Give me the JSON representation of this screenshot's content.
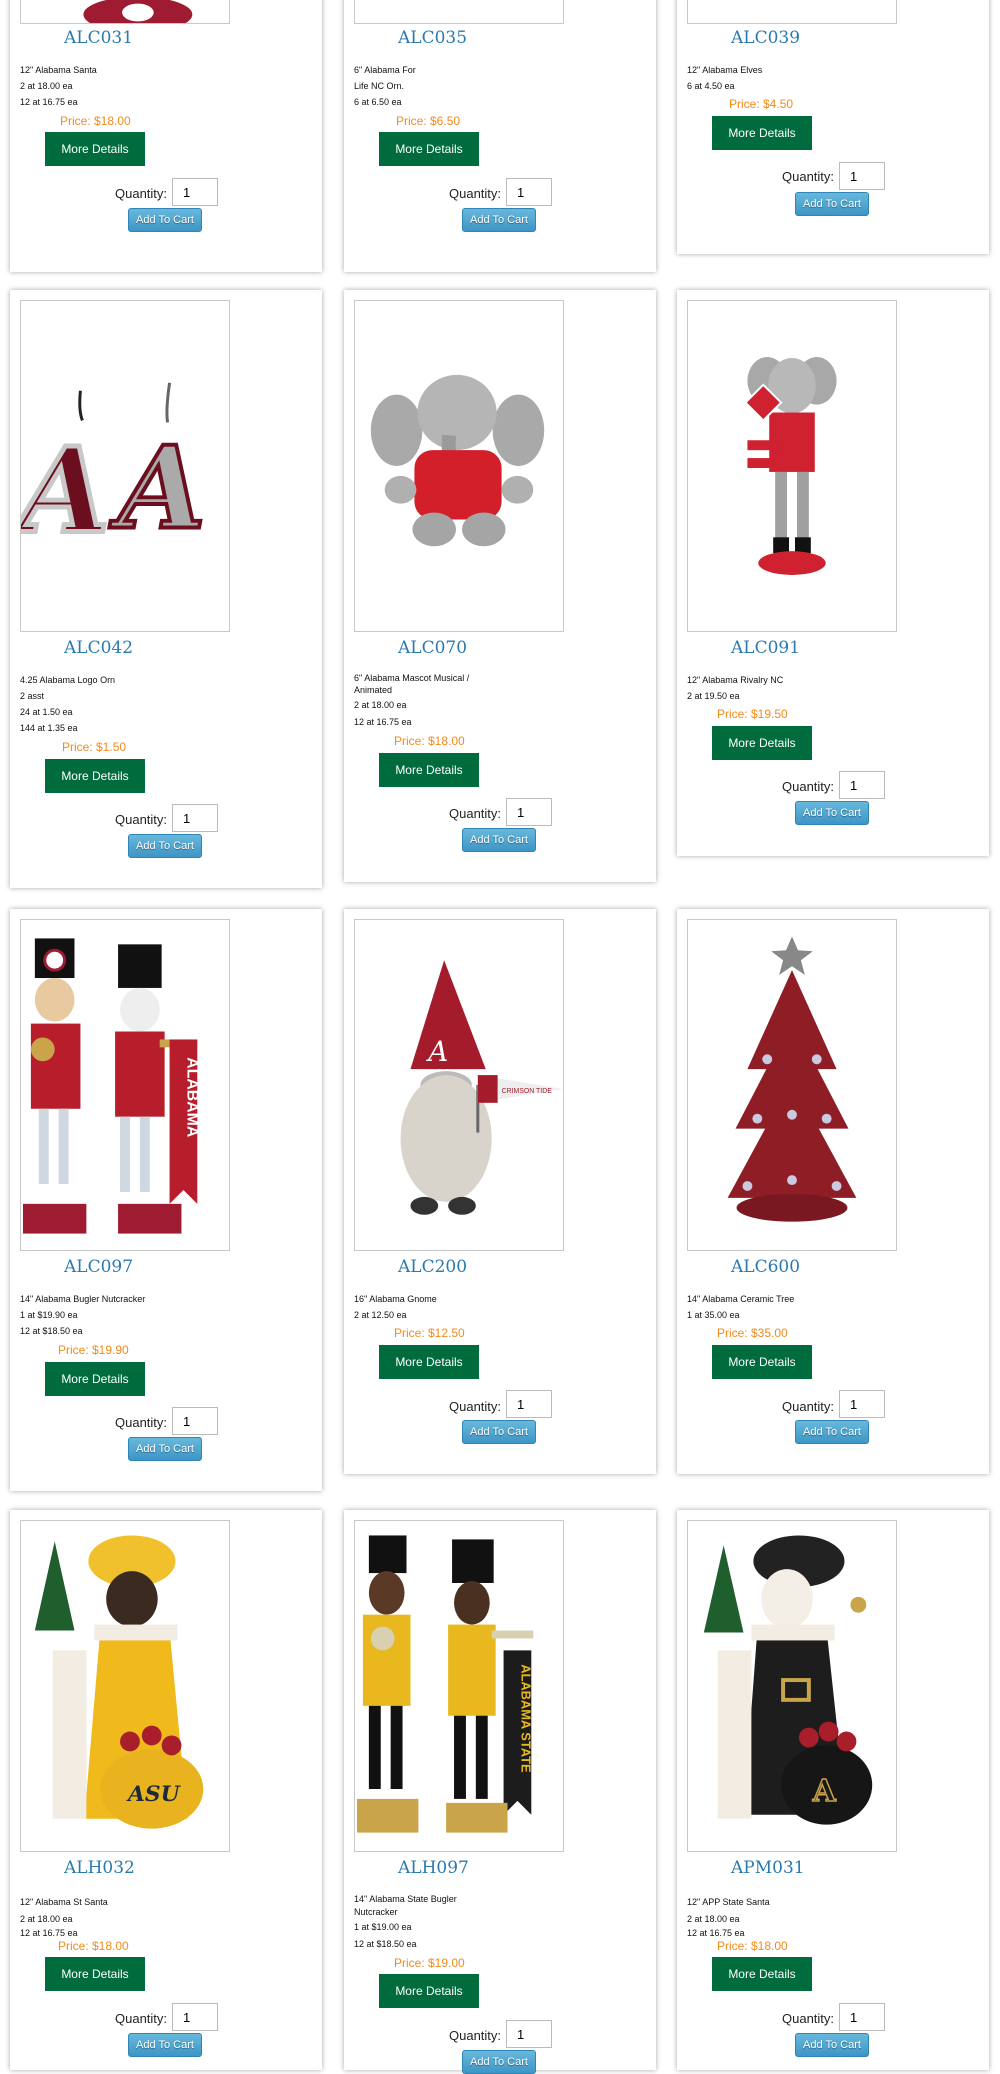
{
  "labels": {
    "more_details": "More Details",
    "quantity": "Quantity:",
    "add_to_cart": "Add To Cart",
    "default_qty": "1"
  },
  "products": {
    "alc031": {
      "code": "ALC031",
      "lines": [
        "12\" Alabama Santa",
        "2 at 18.00 ea",
        "12 at 16.75 ea"
      ],
      "price": "Price: $18.00"
    },
    "alc035": {
      "code": "ALC035",
      "lines": [
        "6\" Alabama For",
        "Life NC Orn.",
        "6 at 6.50 ea"
      ],
      "price": "Price: $6.50"
    },
    "alc039": {
      "code": "ALC039",
      "lines": [
        "12\" Alabama Elves",
        "6 at 4.50 ea"
      ],
      "price": "Price: $4.50"
    },
    "alc042": {
      "code": "ALC042",
      "lines": [
        "4.25 Alabama Logo Orn",
        "2 asst",
        "24 at 1.50 ea",
        "144 at 1.35 ea"
      ],
      "price": "Price: $1.50"
    },
    "alc070": {
      "code": "ALC070",
      "lines": [
        "6\" Alabama Mascot Musical /",
        "Animated",
        "2 at 18.00 ea",
        "12 at 16.75 ea"
      ],
      "price": "Price: $18.00"
    },
    "alc091": {
      "code": "ALC091",
      "lines": [
        "12\" Alabama Rivalry NC",
        "2 at 19.50 ea"
      ],
      "price": "Price: $19.50"
    },
    "alc097": {
      "code": "ALC097",
      "lines": [
        "14\" Alabama Bugler Nutcracker",
        "1 at $19.90 ea",
        "12 at $18.50 ea"
      ],
      "price": "Price: $19.90"
    },
    "alc200": {
      "code": "ALC200",
      "lines": [
        "16\" Alabama Gnome",
        "2 at 12.50 ea"
      ],
      "price": "Price: $12.50"
    },
    "alc600": {
      "code": "ALC600",
      "lines": [
        "14\" Alabama Ceramic Tree",
        "1 at 35.00 ea"
      ],
      "price": "Price: $35.00"
    },
    "alh032": {
      "code": "ALH032",
      "lines": [
        "12\" Alabama St Santa",
        "2 at 18.00 ea",
        "12 at 16.75 ea"
      ],
      "price": "Price: $18.00"
    },
    "alh097": {
      "code": "ALH097",
      "lines": [
        "14\" Alabama State Bugler",
        "Nutcracker",
        "1 at $19.00 ea",
        "12 at $18.50 ea"
      ],
      "price": "Price: $19.00"
    },
    "apm031": {
      "code": "APM031",
      "lines": [
        "12\" APP State Santa",
        "2 at 18.00 ea",
        "12 at 16.75 ea"
      ],
      "price": "Price: $18.00"
    }
  },
  "image_text": {
    "alabama_banner": "ALABAMA",
    "crimson_tide": "CRIMSON TIDE",
    "alabama_state_banner": "ALABAMA STATE",
    "asu": "ASU"
  },
  "colors": {
    "button_green": "#006b3c",
    "code_blue": "#2a7ab0",
    "price_orange": "#f28a1c",
    "cart_blue": "#3d96c6",
    "crimson": "#9e1b32"
  }
}
